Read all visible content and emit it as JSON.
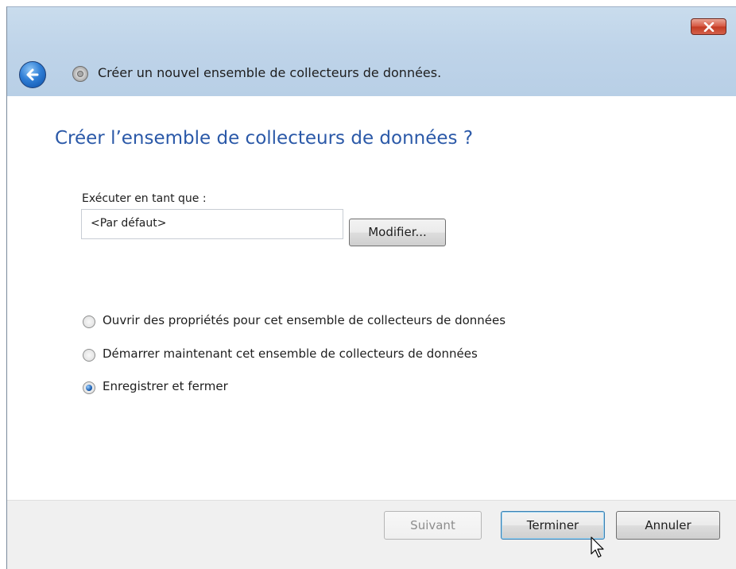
{
  "window": {
    "title": "Créer un nouvel ensemble de collecteurs de données.",
    "close_icon": "close-icon",
    "back_icon": "back-arrow-icon",
    "wizard_icon": "data-collector-icon"
  },
  "page": {
    "heading": "Créer l’ensemble de collecteurs de données ?",
    "run_as_label": "Exécuter en tant que :",
    "run_as_value": "<Par défaut>",
    "modify_button": "Modifier..."
  },
  "options": [
    {
      "label": "Ouvrir des propriétés pour cet ensemble de collecteurs de données",
      "selected": false
    },
    {
      "label": "Démarrer maintenant cet ensemble de collecteurs de données",
      "selected": false
    },
    {
      "label": "Enregistrer et fermer",
      "selected": true
    }
  ],
  "footer": {
    "next_button": "Suivant",
    "finish_button": "Terminer",
    "cancel_button": "Annuler"
  },
  "colors": {
    "heading": "#2b59a8",
    "titlebar": "#bfd4e9",
    "footer": "#f0f0f0",
    "close_button": "#c23a22"
  }
}
